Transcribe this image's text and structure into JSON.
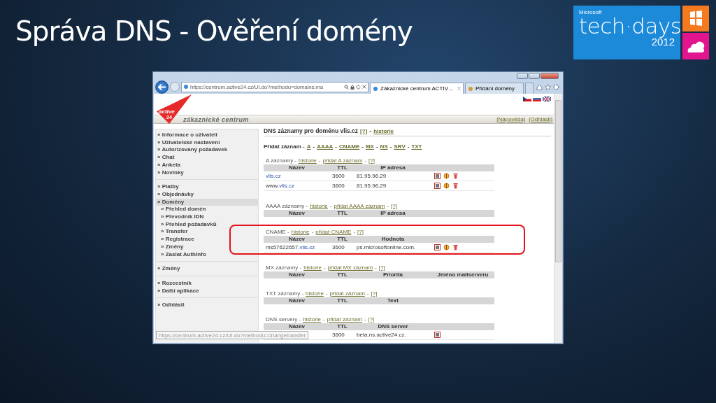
{
  "slide": {
    "title": "Správa DNS - Ověření domény"
  },
  "event_logo": {
    "brand": "Microsoft",
    "name": "tech·days",
    "year": "2012"
  },
  "browser": {
    "address": "https://centrum.active24.cz/UI.do?methodu=domains.ma",
    "tabs": [
      {
        "label": "Zákaznické centrum ACTIV…",
        "selected": true
      },
      {
        "label": "Přidání domény",
        "selected": false
      }
    ],
    "status_url": "https://centrum.active24.cz/UI.do?methodu=changetransfer"
  },
  "site": {
    "logo_text": "active",
    "logo_suffix": "24",
    "subtitle": "zákaznické centrum",
    "header_links": [
      "[Nápověda]",
      "[Odhlásit]"
    ]
  },
  "sidebar": {
    "groups": [
      [
        {
          "label": "» Informace o uživateli",
          "selected": false
        },
        {
          "label": "» Uživatelské nastavení",
          "selected": false
        },
        {
          "label": "» Autorizovaný požadavek",
          "selected": false
        },
        {
          "label": "» Chat",
          "selected": false
        },
        {
          "label": "» Anketa",
          "selected": false
        },
        {
          "label": "» Novinky",
          "selected": false
        }
      ],
      [
        {
          "label": "» Platby",
          "selected": false
        },
        {
          "label": "» Objednávky",
          "selected": false
        },
        {
          "label": "» Domény",
          "selected": true,
          "children": [
            {
              "label": "» Přehled domén",
              "selected": false
            },
            {
              "label": "» Převodník IDN",
              "selected": false
            },
            {
              "label": "» Přehled požadavků",
              "selected": false
            },
            {
              "label": "» Transfer",
              "selected": false
            },
            {
              "label": "» Registrace",
              "selected": false
            },
            {
              "label": "» Změny",
              "selected": false
            },
            {
              "label": "» Zaslat AuthInfo",
              "selected": false
            }
          ]
        }
      ],
      [
        {
          "label": "» Změny",
          "selected": false
        }
      ],
      [
        {
          "label": "» Rozcestník",
          "selected": false
        },
        {
          "label": "» Další aplikace",
          "selected": false
        }
      ],
      [
        {
          "label": "» Odhlásit",
          "selected": false
        }
      ]
    ]
  },
  "main": {
    "heading": [
      {
        "kind": "text",
        "text": "DNS záznamy pro doménu vlis.cz"
      },
      {
        "kind": "link",
        "text": "[?]"
      },
      {
        "kind": "text",
        "text": "-"
      },
      {
        "kind": "link",
        "text": "historie"
      }
    ],
    "add_line": [
      {
        "kind": "text",
        "text": "Přidat záznam -"
      },
      {
        "kind": "link",
        "text": "A"
      },
      {
        "kind": "text",
        "text": "-"
      },
      {
        "kind": "link",
        "text": "AAAA"
      },
      {
        "kind": "text",
        "text": "-"
      },
      {
        "kind": "link",
        "text": "CNAME"
      },
      {
        "kind": "text",
        "text": "-"
      },
      {
        "kind": "link",
        "text": "MX"
      },
      {
        "kind": "text",
        "text": "-"
      },
      {
        "kind": "link",
        "text": "NS"
      },
      {
        "kind": "text",
        "text": "-"
      },
      {
        "kind": "link",
        "text": "SRV"
      },
      {
        "kind": "text",
        "text": "-"
      },
      {
        "kind": "link",
        "text": "TXT"
      }
    ],
    "sections": [
      {
        "highlighted": false,
        "caption": [
          {
            "kind": "text",
            "text": "A záznamy -"
          },
          {
            "kind": "link",
            "text": "historie"
          },
          {
            "kind": "text",
            "text": "-"
          },
          {
            "kind": "link",
            "text": "přidat A záznam"
          },
          {
            "kind": "text",
            "text": "-"
          },
          {
            "kind": "link",
            "text": "[?]"
          }
        ],
        "columns": [
          "Název",
          "TTL",
          "IP adresa"
        ],
        "rows": [
          {
            "name_plain": "",
            "name_link": "vlis.cz",
            "ttl": "3600",
            "value": "81.95.96.29",
            "actions": {
              "edit": true,
              "toggle": true,
              "delete": true
            }
          },
          {
            "name_plain": "www.",
            "name_link": "vlis.cz",
            "ttl": "3600",
            "value": "81.95.96.29",
            "actions": {
              "edit": true,
              "toggle": true,
              "delete": true
            }
          }
        ]
      },
      {
        "highlighted": false,
        "caption": [
          {
            "kind": "text",
            "text": "AAAA záznamy -"
          },
          {
            "kind": "link",
            "text": "historie"
          },
          {
            "kind": "text",
            "text": "-"
          },
          {
            "kind": "link",
            "text": "přidat AAAA záznam"
          },
          {
            "kind": "text",
            "text": "-"
          },
          {
            "kind": "link",
            "text": "[?]"
          }
        ],
        "columns": [
          "Název",
          "TTL",
          "IP adresa"
        ]
      },
      {
        "highlighted": true,
        "caption": [
          {
            "kind": "text",
            "text": "CNAME -"
          },
          {
            "kind": "link",
            "text": "historie"
          },
          {
            "kind": "text",
            "text": "-"
          },
          {
            "kind": "link",
            "text": "přidat CNAME"
          },
          {
            "kind": "text",
            "text": "-"
          },
          {
            "kind": "link",
            "text": "[?]"
          }
        ],
        "columns": [
          "Název",
          "TTL",
          "Hodnota"
        ],
        "rows": [
          {
            "name_plain": "ms57622657.",
            "name_link": "vlis.cz",
            "ttl": "3600",
            "value": "ps.microsoftonline.com.",
            "actions": {
              "edit": true,
              "toggle": true,
              "delete": true
            }
          }
        ]
      },
      {
        "highlighted": false,
        "caption": [
          {
            "kind": "text",
            "text": "MX záznamy -"
          },
          {
            "kind": "link",
            "text": "historie"
          },
          {
            "kind": "text",
            "text": "-"
          },
          {
            "kind": "link",
            "text": "přidat MX záznam"
          },
          {
            "kind": "text",
            "text": "-"
          },
          {
            "kind": "link",
            "text": "[?]"
          }
        ],
        "columns": [
          "Název",
          "TTL",
          "Priorita",
          "Jméno mailserveru"
        ]
      },
      {
        "highlighted": false,
        "caption": [
          {
            "kind": "text",
            "text": "TXT záznamy -"
          },
          {
            "kind": "link",
            "text": "historie"
          },
          {
            "kind": "text",
            "text": "-"
          },
          {
            "kind": "link",
            "text": "přidat záznam"
          },
          {
            "kind": "text",
            "text": "-"
          },
          {
            "kind": "link",
            "text": "[?]"
          }
        ],
        "columns": [
          "Název",
          "TTL",
          "Text"
        ]
      },
      {
        "highlighted": false,
        "caption": [
          {
            "kind": "text",
            "text": "DNS servery -"
          },
          {
            "kind": "link",
            "text": "historie"
          },
          {
            "kind": "text",
            "text": "-"
          },
          {
            "kind": "link",
            "text": "přidat záznam"
          },
          {
            "kind": "text",
            "text": "-"
          },
          {
            "kind": "link",
            "text": "[?]"
          }
        ],
        "columns": [
          "Název",
          "TTL",
          "DNS server"
        ],
        "rows": [
          {
            "ttl": "3600",
            "value": "beta.ns.active24.cz.",
            "actions": {
              "edit": true,
              "toggle": false,
              "delete": false
            }
          }
        ]
      }
    ]
  }
}
